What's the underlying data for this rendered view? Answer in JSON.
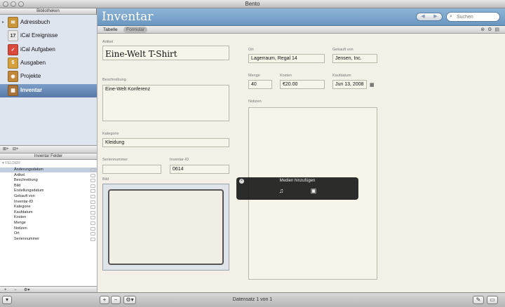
{
  "window": {
    "title": "Bento"
  },
  "sidebar": {
    "libraries_title": "Bibliotheken",
    "libraries": [
      {
        "label": "Adressbuch",
        "icon": "address-book-icon",
        "color": "#c9963b",
        "glyph": "✉",
        "has_arrow": true
      },
      {
        "label": "iCal Ereignisse",
        "icon": "calendar-icon",
        "color": "#e8e8e8",
        "glyph": "17",
        "has_arrow": false
      },
      {
        "label": "iCal Aufgaben",
        "icon": "tasks-icon",
        "color": "#d94a3c",
        "glyph": "✓",
        "has_arrow": false
      },
      {
        "label": "Ausgaben",
        "icon": "expenses-icon",
        "color": "#d6a13a",
        "glyph": "$",
        "has_arrow": false
      },
      {
        "label": "Projekte",
        "icon": "projects-icon",
        "color": "#c2883a",
        "glyph": "◉",
        "has_arrow": false
      },
      {
        "label": "Inventar",
        "icon": "inventory-icon",
        "color": "#a8743b",
        "glyph": "▦",
        "has_arrow": false,
        "selected": true
      }
    ],
    "footer_buttons": [
      "⊞+",
      "⊟+"
    ],
    "fields_title": "Inventar Felder",
    "fields_group": "FELDER",
    "fields": [
      {
        "label": "Änderungsdatum",
        "selected": true
      },
      {
        "label": "Artikel"
      },
      {
        "label": "Beschreibung"
      },
      {
        "label": "Bild"
      },
      {
        "label": "Erstellungsdatum"
      },
      {
        "label": "Gekauft von"
      },
      {
        "label": "Inventar-ID"
      },
      {
        "label": "Kategorie"
      },
      {
        "label": "Kaufdatum"
      },
      {
        "label": "Kosten"
      },
      {
        "label": "Menge"
      },
      {
        "label": "Notizen"
      },
      {
        "label": "Ort"
      },
      {
        "label": "Seriennummer"
      }
    ],
    "bottom_buttons": [
      "+",
      "−",
      "⚙▾"
    ]
  },
  "main": {
    "title": "Inventar",
    "nav": {
      "prev": "◀",
      "next": "▶"
    },
    "search": {
      "icon": "search-icon",
      "placeholder": "Suchen"
    },
    "tabs": [
      {
        "label": "Tabelle",
        "active": false
      },
      {
        "label": "Formular",
        "active": true
      }
    ],
    "tab_icons": "⊗⚙▤",
    "form": {
      "artikel": {
        "label": "Artikel",
        "value": "Eine-Welt T-Shirt"
      },
      "beschreibung": {
        "label": "Beschreibung",
        "value": "Eine-Welt Konferenz"
      },
      "kategorie": {
        "label": "Kategorie",
        "value": "Kleidung"
      },
      "seriennummer": {
        "label": "Seriennummer",
        "value": ""
      },
      "inventar_id": {
        "label": "Inventar-ID",
        "value": "0614"
      },
      "bild": {
        "label": "Bild"
      },
      "ort": {
        "label": "Ort",
        "value": "Lagerraum, Regal 14"
      },
      "gekauft_von": {
        "label": "Gekauft von",
        "value": "Jensen, Inc."
      },
      "menge": {
        "label": "Menge",
        "value": "40"
      },
      "kosten": {
        "label": "Kosten",
        "value": "€20.00"
      },
      "kaufdatum": {
        "label": "Kaufdatum",
        "value": "Jun 13, 2008"
      },
      "notizen": {
        "label": "Notizen",
        "value": ""
      }
    }
  },
  "popup": {
    "title": "Medien hinzufügen",
    "close": "×",
    "buttons": [
      {
        "icon": "media-browser-icon",
        "glyph": "♫"
      },
      {
        "icon": "insert-image-icon",
        "glyph": "▣"
      }
    ]
  },
  "bottombar": {
    "status": "Datensatz 1 von 1",
    "buttons": [
      "+",
      "−",
      "⚙▾"
    ],
    "right_buttons": [
      "✎",
      "▭"
    ]
  }
}
